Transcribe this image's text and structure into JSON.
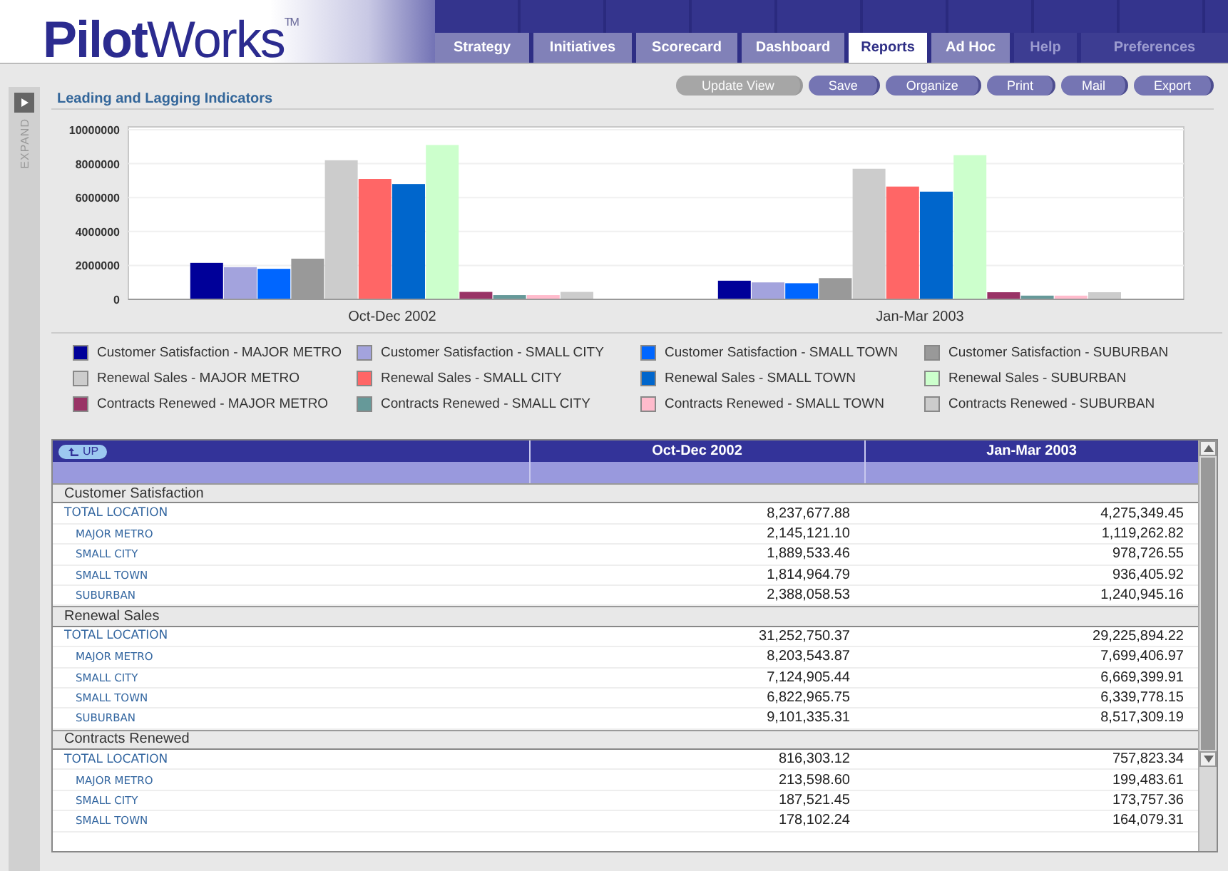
{
  "logo": "**Pilot**Works$^{TM}$",
  "tabs": [
    {
      "label": "Strategy",
      "selected": false,
      "disabled": false
    },
    {
      "label": "Initiatives",
      "selected": false,
      "disabled": false
    },
    {
      "label": "Scorecard",
      "selected": false,
      "disabled": false
    },
    {
      "label": "Dashboard",
      "selected": false,
      "disabled": false
    },
    {
      "label": "Reports",
      "selected": true,
      "disabled": false
    },
    {
      "label": "Ad Hoc",
      "selected": false,
      "disabled": false
    },
    {
      "label": "Help",
      "selected": false,
      "disabled": true
    },
    {
      "label": "Preferences",
      "selected": false,
      "disabled": true
    }
  ],
  "sidebar": {
    "expand_label": "EXPAND"
  },
  "page_title": "Leading and Lagging Indicators",
  "actions": [
    {
      "label": "Update View",
      "disabled": true
    },
    {
      "label": "Save",
      "disabled": false
    },
    {
      "label": "Organize",
      "disabled": false
    },
    {
      "label": "Print",
      "disabled": false
    },
    {
      "label": "Mail",
      "disabled": false
    },
    {
      "label": "Export",
      "disabled": false
    }
  ],
  "chart_data": {
    "type": "bar",
    "grid": true,
    "categories": [
      "Oct-Dec 2002",
      "Jan-Mar 2003"
    ],
    "ylim": [
      0,
      10000000
    ],
    "yticks": [
      0,
      2000000,
      4000000,
      6000000,
      8000000,
      10000000
    ],
    "series": [
      {
        "name": "Customer Satisfaction - MAJOR METRO",
        "color": "#000099",
        "values": [
          2150000,
          1100000
        ]
      },
      {
        "name": "Customer Satisfaction - SMALL CITY",
        "color": "#a3a3dd",
        "values": [
          1900000,
          1000000
        ]
      },
      {
        "name": "Customer Satisfaction - SMALL TOWN",
        "color": "#0066ff",
        "values": [
          1800000,
          950000
        ]
      },
      {
        "name": "Customer Satisfaction - SUBURBAN",
        "color": "#999999",
        "values": [
          2400000,
          1250000
        ]
      },
      {
        "name": "Renewal Sales - MAJOR METRO",
        "color": "#cccccc",
        "values": [
          8200000,
          7700000
        ]
      },
      {
        "name": "Renewal Sales - SMALL CITY",
        "color": "#ff6666",
        "values": [
          7100000,
          6650000
        ]
      },
      {
        "name": "Renewal Sales - SMALL TOWN",
        "color": "#0066cc",
        "values": [
          6800000,
          6350000
        ]
      },
      {
        "name": "Renewal Sales - SUBURBAN",
        "color": "#ccffcc",
        "values": [
          9100000,
          8500000
        ]
      },
      {
        "name": "Contracts Renewed - MAJOR METRO",
        "color": "#993366",
        "values": [
          440000,
          420000
        ]
      },
      {
        "name": "Contracts Renewed - SMALL CITY",
        "color": "#669999",
        "values": [
          250000,
          220000
        ]
      },
      {
        "name": "Contracts Renewed - SMALL TOWN",
        "color": "#ffbbcc",
        "values": [
          250000,
          220000
        ]
      },
      {
        "name": "Contracts Renewed - SUBURBAN",
        "color": "#cccccc",
        "values": [
          440000,
          420000
        ]
      }
    ]
  },
  "table": {
    "up_button": "UP",
    "columns": [
      "Oct-Dec 2002",
      "Jan-Mar 2003"
    ],
    "groups": [
      {
        "name": "Customer Satisfaction",
        "rows": [
          {
            "label": "TOTAL LOCATION",
            "values": [
              "8,237,677.88",
              "4,275,349.45"
            ],
            "children": [
              {
                "label": "MAJOR METRO",
                "values": [
                  "2,145,121.10",
                  "1,119,262.82"
                ]
              },
              {
                "label": "SMALL CITY",
                "values": [
                  "1,889,533.46",
                  "978,726.55"
                ]
              },
              {
                "label": "SMALL TOWN",
                "values": [
                  "1,814,964.79",
                  "936,405.92"
                ]
              },
              {
                "label": "SUBURBAN",
                "values": [
                  "2,388,058.53",
                  "1,240,945.16"
                ]
              }
            ]
          }
        ]
      },
      {
        "name": "Renewal Sales",
        "rows": [
          {
            "label": "TOTAL LOCATION",
            "values": [
              "31,252,750.37",
              "29,225,894.22"
            ],
            "children": [
              {
                "label": "MAJOR METRO",
                "values": [
                  "8,203,543.87",
                  "7,699,406.97"
                ]
              },
              {
                "label": "SMALL CITY",
                "values": [
                  "7,124,905.44",
                  "6,669,399.91"
                ]
              },
              {
                "label": "SMALL TOWN",
                "values": [
                  "6,822,965.75",
                  "6,339,778.15"
                ]
              },
              {
                "label": "SUBURBAN",
                "values": [
                  "9,101,335.31",
                  "8,517,309.19"
                ]
              }
            ]
          }
        ]
      },
      {
        "name": "Contracts Renewed",
        "rows": [
          {
            "label": "TOTAL LOCATION",
            "values": [
              "816,303.12",
              "757,823.34"
            ],
            "children": [
              {
                "label": "MAJOR METRO",
                "values": [
                  "213,598.60",
                  "199,483.61"
                ]
              },
              {
                "label": "SMALL CITY",
                "values": [
                  "187,521.45",
                  "173,757.36"
                ]
              },
              {
                "label": "SMALL TOWN",
                "values": [
                  "178,102.24",
                  "164,079.31"
                ]
              }
            ]
          }
        ]
      }
    ]
  }
}
